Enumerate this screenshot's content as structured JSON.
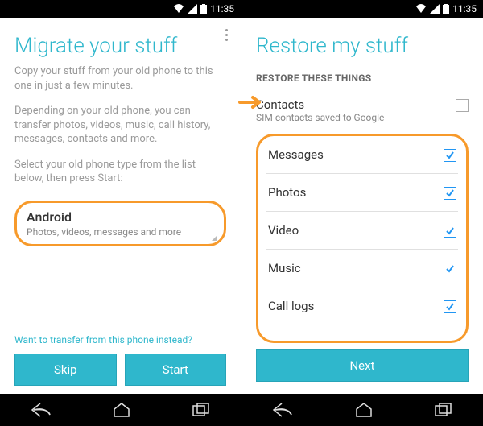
{
  "status": {
    "time": "11:35"
  },
  "left": {
    "title": "Migrate your stuff",
    "intro": "Copy your stuff from your old phone to this one in just a few minutes.",
    "detail": "Depending on your old phone, you can transfer photos, videos, music, call history, messages, contacts and more.",
    "prompt": "Select your old phone type from the list below, then press Start:",
    "selector": {
      "primary": "Android",
      "secondary": "Photos, videos, messages and more"
    },
    "link": "Want to transfer from this phone instead?",
    "skip": "Skip",
    "start": "Start"
  },
  "right": {
    "title": "Restore my stuff",
    "section": "RESTORE THESE THINGS",
    "contacts": {
      "label": "Contacts",
      "sub": "SIM contacts saved to Google"
    },
    "items": {
      "0": "Messages",
      "1": "Photos",
      "2": "Video",
      "3": "Music",
      "4": "Call logs"
    },
    "next": "Next"
  }
}
